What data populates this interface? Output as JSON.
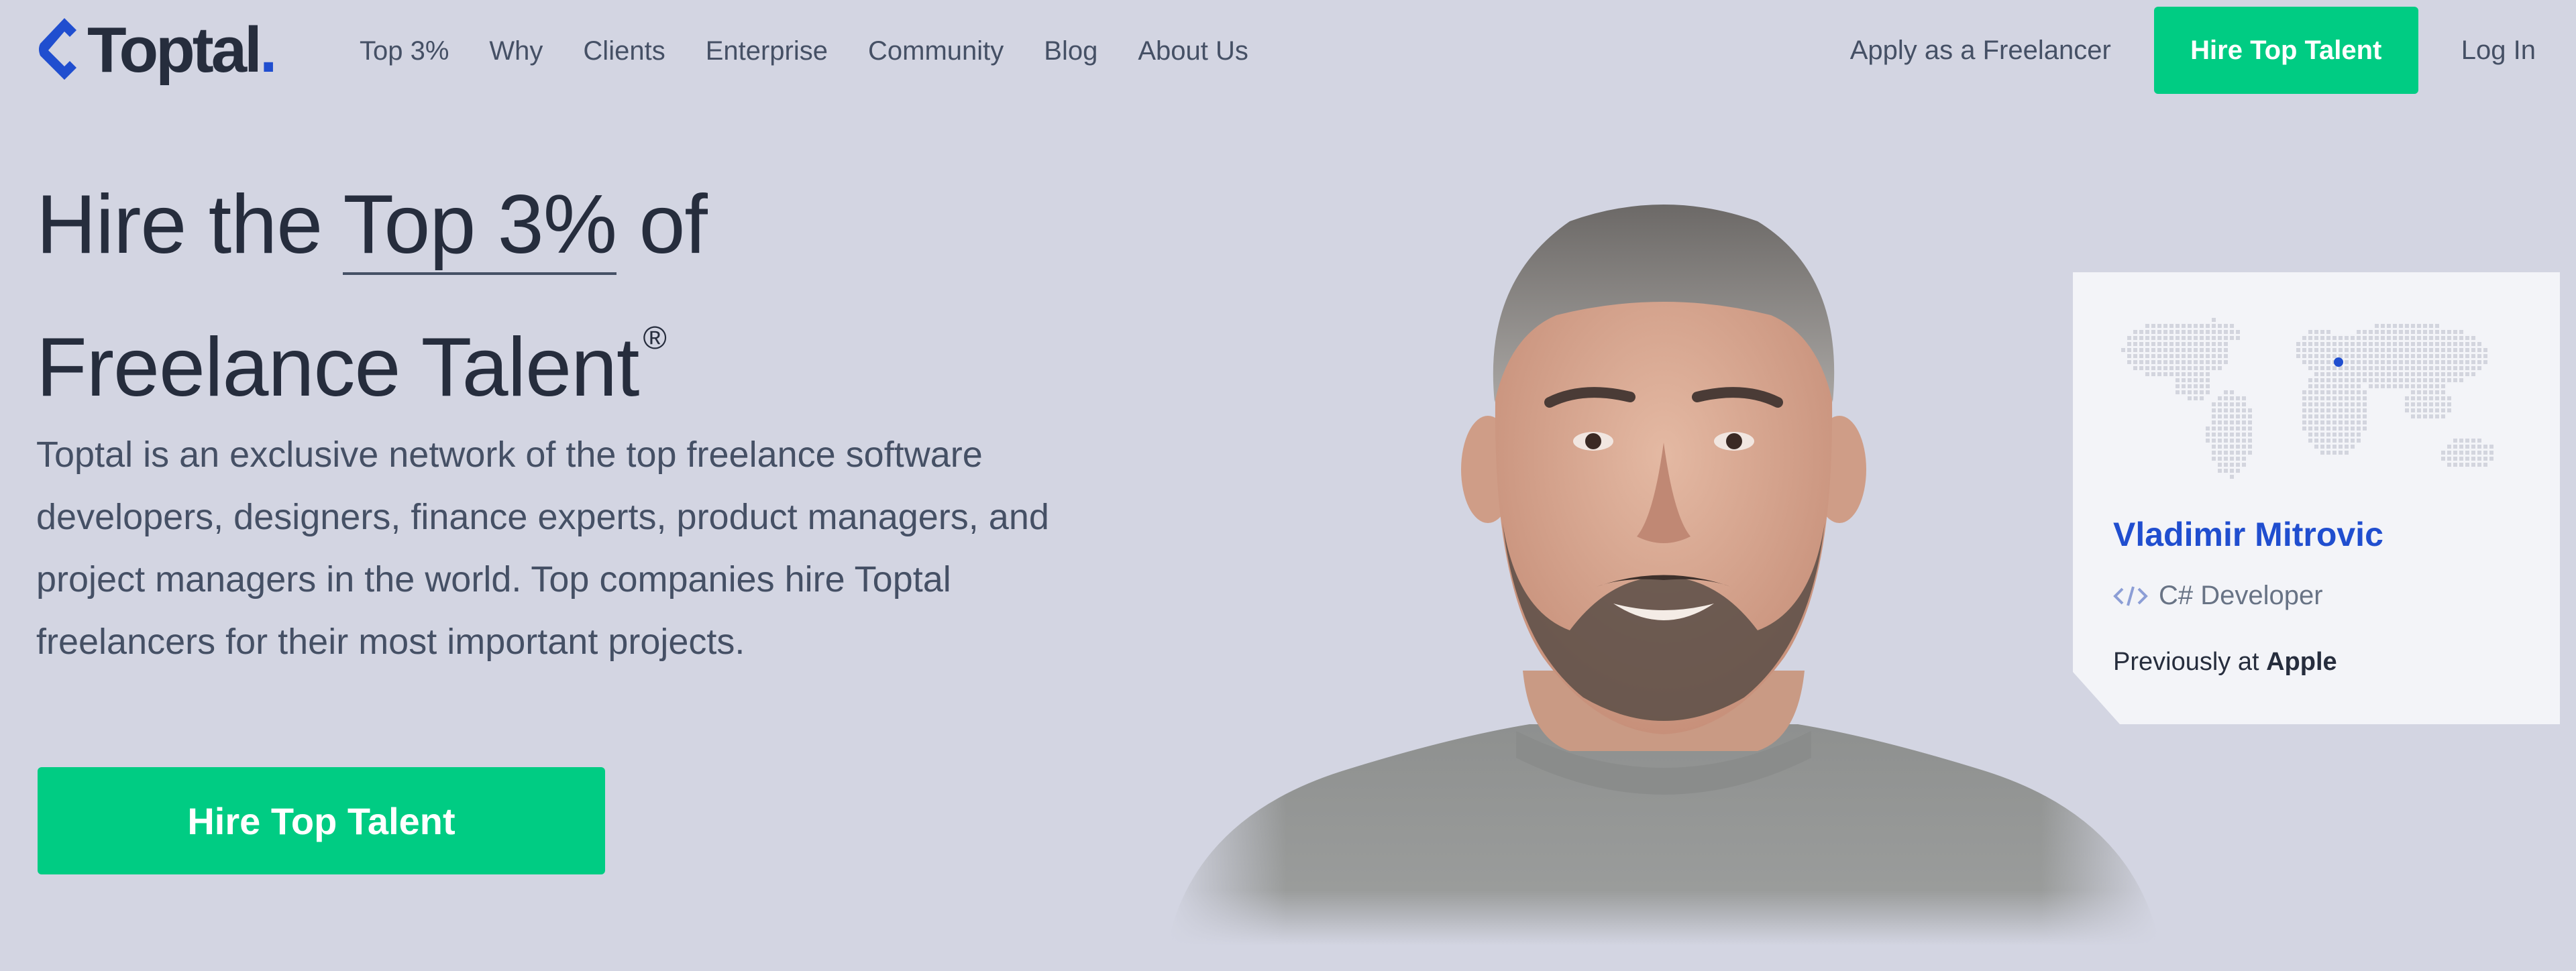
{
  "brand": {
    "name": "Toptal",
    "dot": "."
  },
  "nav": {
    "links": [
      "Top 3%",
      "Why",
      "Clients",
      "Enterprise",
      "Community",
      "Blog",
      "About Us"
    ],
    "apply": "Apply as a Freelancer",
    "hire": "Hire Top Talent",
    "login": "Log In"
  },
  "hero": {
    "headline_pre": "Hire the",
    "headline_highlight": "Top 3%",
    "headline_post": "of",
    "headline_line2": "Freelance Talent",
    "registered": "®",
    "description": "Toptal is an exclusive network of the top freelance software developers, designers, finance experts, product managers, and project managers in the world. Top companies hire Toptal freelancers for their most important projects.",
    "cta": "Hire Top Talent"
  },
  "profile": {
    "name": "Vladimir Mitrovic",
    "role": "C# Developer",
    "previously_label": "Previously at",
    "previously_company": "Apple"
  },
  "colors": {
    "background": "#d3d5e2",
    "accent_green": "#00cc83",
    "brand_blue": "#204ecf",
    "text_dark": "#262d3d",
    "text_muted": "#455065"
  },
  "icons": {
    "logo": "toptal-logo-icon",
    "code": "code-icon",
    "map": "world-map-icon"
  }
}
